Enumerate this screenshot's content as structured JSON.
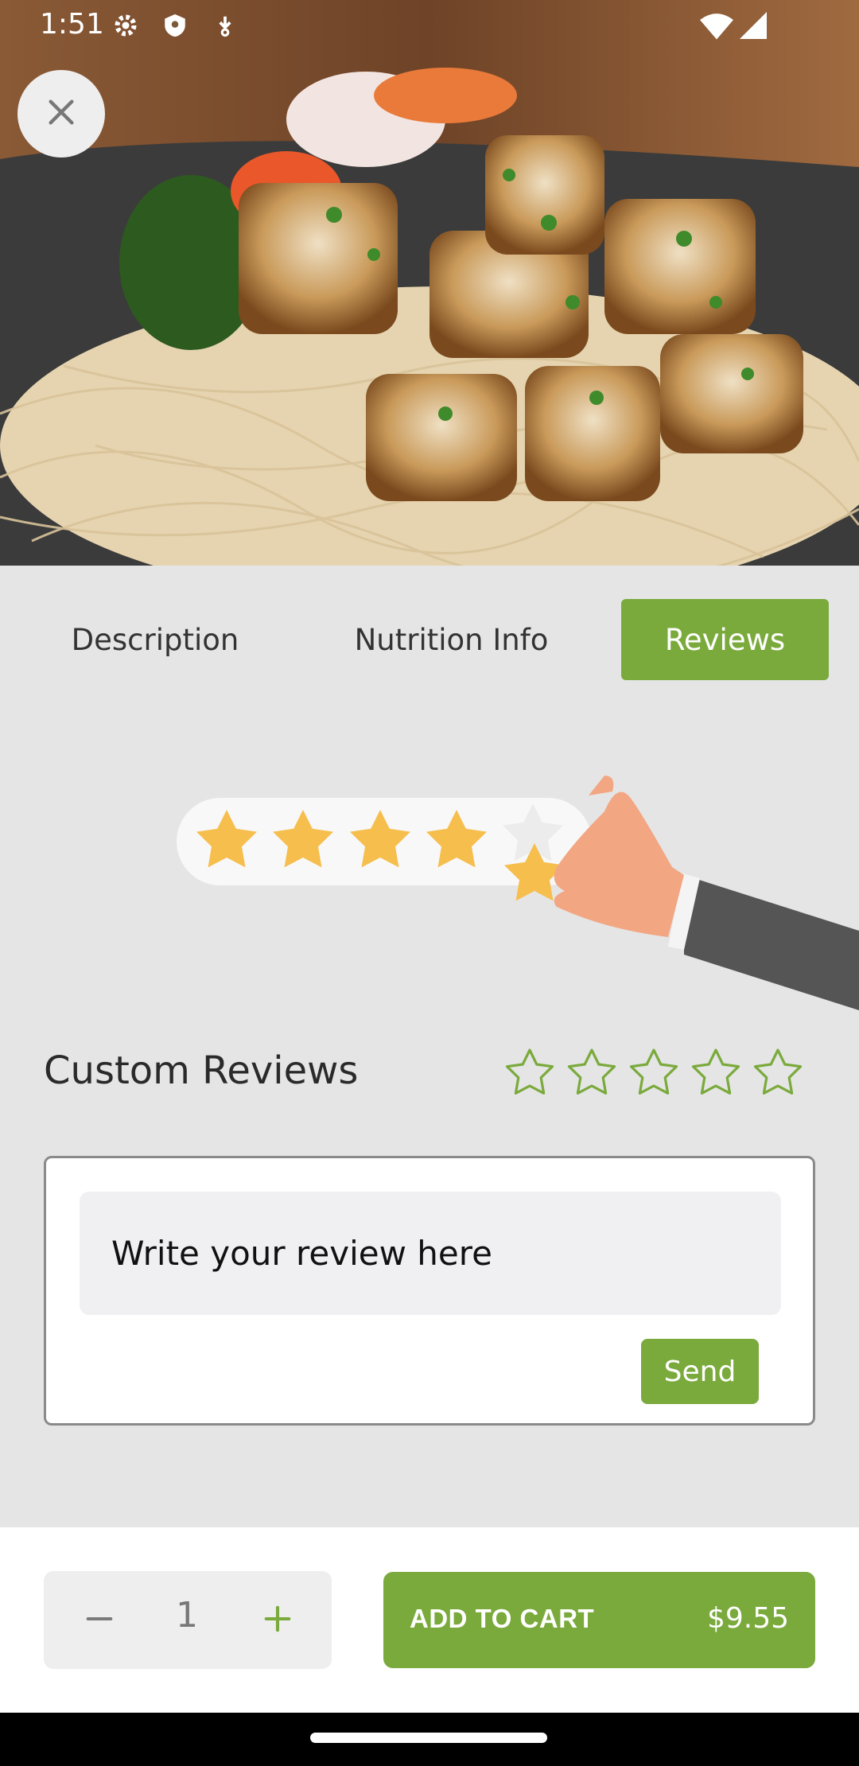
{
  "status_bar": {
    "time": "1:51",
    "icons": [
      "settings-icon",
      "shield-icon",
      "download-icon",
      "wifi-icon",
      "signal-icon"
    ]
  },
  "hero": {
    "image": "chicken-noodle-dish-photo"
  },
  "tabs": [
    {
      "label": "Description",
      "active": false
    },
    {
      "label": "Nutrition Info",
      "active": false
    },
    {
      "label": "Reviews",
      "active": true
    }
  ],
  "illustration": {
    "rating_shown": 4,
    "rating_max": 5
  },
  "custom_reviews": {
    "title": "Custom Reviews",
    "rating": 0,
    "rating_max": 5,
    "input_placeholder": "Write your review here",
    "send_label": "Send"
  },
  "cart": {
    "quantity": "1",
    "add_label": "ADD TO CART",
    "price": "$9.55"
  },
  "colors": {
    "accent": "#7aaa3c",
    "star_gold": "#f6be4d"
  }
}
